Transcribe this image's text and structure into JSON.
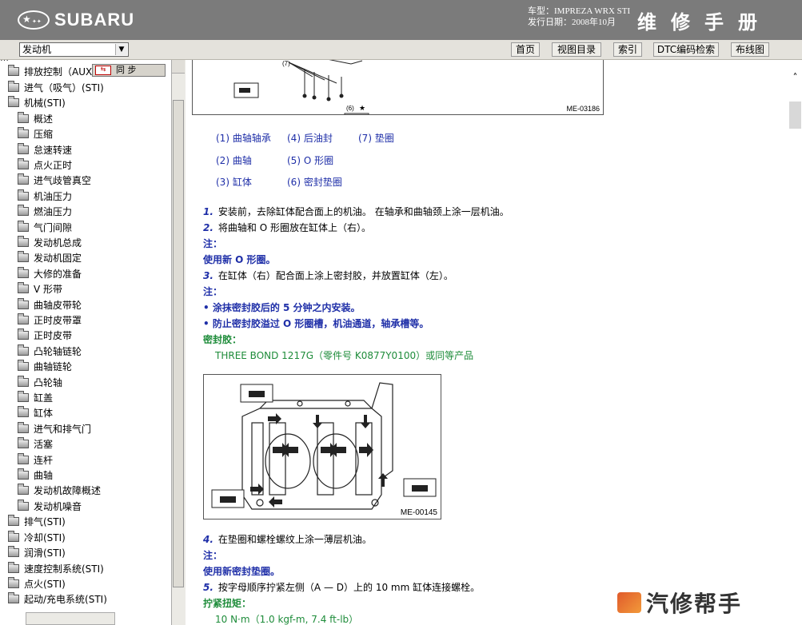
{
  "header": {
    "brand": "SUBARU",
    "model_line": "车型：IMPREZA WRX STI",
    "date_line": "发行日期：2008年10月",
    "title": "维修手册"
  },
  "toolbar": {
    "section_select": "发动机",
    "buttons": [
      "首页",
      "视图目录",
      "索引",
      "DTC编码检索",
      "布线图"
    ]
  },
  "sidebar": {
    "sync_label": "同  步",
    "items": [
      "排放控制（AUX",
      "进气（吸气）(STI)",
      "机械(STI)",
      "概述",
      "压缩",
      "怠速转速",
      "点火正时",
      "进气歧管真空",
      "机油压力",
      "燃油压力",
      "气门间隙",
      "发动机总成",
      "发动机固定",
      "大修的准备",
      "V 形带",
      "曲轴皮带轮",
      "正时皮带罩",
      "正时皮带",
      "凸轮轴链轮",
      "曲轴链轮",
      "凸轮轴",
      "缸盖",
      "缸体",
      "进气和排气门",
      "活塞",
      "连杆",
      "曲轴",
      "发动机故障概述",
      "发动机噪音",
      "排气(STI)",
      "冷却(STI)",
      "润滑(STI)",
      "速度控制系统(STI)",
      "点火(STI)",
      "起动/充电系统(STI)"
    ]
  },
  "content": {
    "fig1_caption": "ME-03186",
    "fig1_labels": [
      "(7)",
      "(6)"
    ],
    "legend": [
      [
        "(1) 曲轴轴承",
        "(4) 后油封",
        "(7) 垫圈"
      ],
      [
        "(2) 曲轴",
        "(5) O 形圈"
      ],
      [
        "(3) 缸体",
        "(6) 密封垫圈"
      ]
    ],
    "steps": {
      "s1_num": "1.",
      "s1": "安装前，去除缸体配合面上的机油。 在轴承和曲轴颈上涂一层机油。",
      "s2_num": "2.",
      "s2": "将曲轴和 O 形圈放在缸体上（右）。",
      "note1_title": "注：",
      "note1": "使用新 O 形圈。",
      "s3_num": "3.",
      "s3": "在缸体（右）配合面上涂上密封胶，并放置缸体（左）。",
      "note2_title": "注：",
      "note2_a": "• 涂抹密封胶后的 5 分钟之内安装。",
      "note2_b": "• 防止密封胶溢过 O 形圈槽，机油通道，轴承槽等。",
      "sealant_title": "密封胶：",
      "sealant": "THREE BOND 1217G（零件号 K0877Y0100）或同等产品",
      "fig2_caption": "ME-00145",
      "s4_num": "4.",
      "s4": "在垫圈和螺栓螺纹上涂一薄层机油。",
      "note3_title": "注：",
      "note3": "使用新密封垫圈。",
      "s5_num": "5.",
      "s5": "按字母顺序拧紧左侧（A — D）上的 10 mm 缸体连接螺栓。",
      "torque_title": "拧紧扭矩：",
      "torque": "10 N·m（1.0 kgf-m, 7.4 ft-lb）"
    }
  },
  "watermark": "汽修帮手"
}
